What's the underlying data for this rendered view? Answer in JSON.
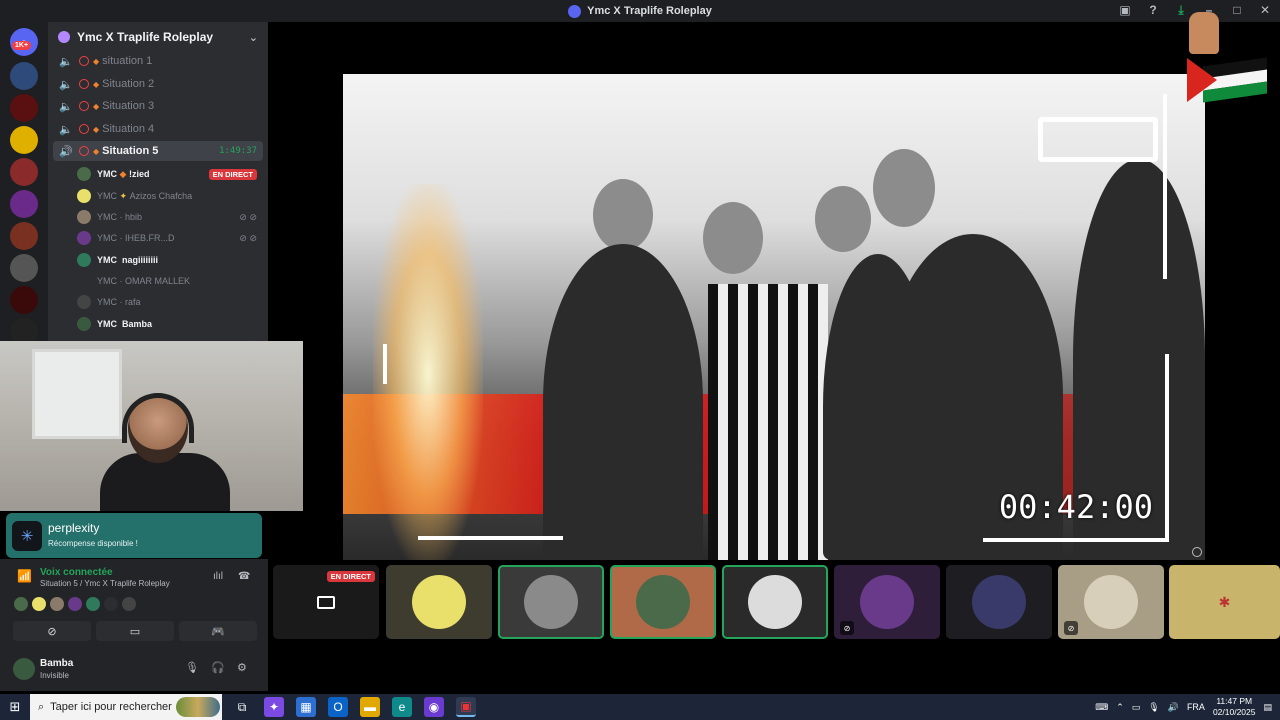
{
  "window": {
    "title": "Ymc X Traplife Roleplay"
  },
  "guilds": {
    "home_badge": "1K+"
  },
  "server": {
    "name": "Ymc X Traplife Roleplay"
  },
  "channels": [
    {
      "name": "situation 1"
    },
    {
      "name": "Situation 2"
    },
    {
      "name": "Situation 3"
    },
    {
      "name": "Situation 4"
    },
    {
      "name": "Situation 5",
      "time": "1:49:37"
    }
  ],
  "members": [
    {
      "prefix": "YMC",
      "name": "!zied",
      "live": "EN DIRECT"
    },
    {
      "prefix": "YMC",
      "name": "Azizos Chafcha"
    },
    {
      "prefix": "YMC",
      "name": "hbib"
    },
    {
      "prefix": "YMC",
      "name": "IHEB.FR...D"
    },
    {
      "prefix": "YMC",
      "name": "nagiiiiiiii"
    },
    {
      "prefix": "YMC",
      "name": "OMAR MALLEK"
    },
    {
      "prefix": "YMC",
      "name": "rafa"
    },
    {
      "prefix": "YMC",
      "name": "Bamba"
    }
  ],
  "promo": {
    "title": "perplexity",
    "subtitle": "Récompense disponible !"
  },
  "voice": {
    "status": "Voix connectée",
    "location": "Situation 5 / Ymc X Traplife Roleplay"
  },
  "user": {
    "name": "Bamba",
    "status": "Invisible"
  },
  "stream": {
    "timer": "00:42:00"
  },
  "tiles": {
    "live_label": "EN DIRECT"
  },
  "taskbar": {
    "search_placeholder": "Taper ici pour rechercher",
    "language": "FRA",
    "time": "11:47 PM",
    "date": "02/10/2025"
  },
  "colors": {
    "accent_green": "#23a55a",
    "live_red": "#da373c",
    "promo_teal": "#24706b"
  }
}
